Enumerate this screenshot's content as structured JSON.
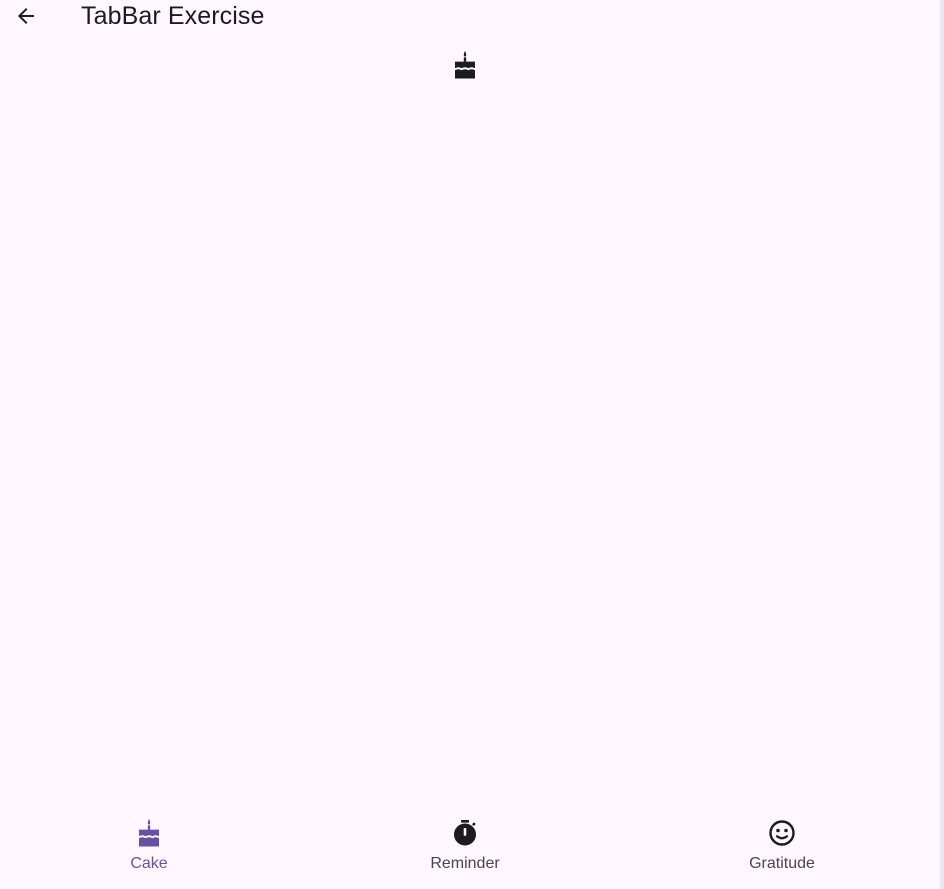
{
  "app_bar": {
    "title": "TabBar Exercise",
    "back_icon": "arrow-back-icon"
  },
  "content": {
    "icon": "cake-icon"
  },
  "tabs": [
    {
      "label": "Cake",
      "icon": "cake-icon",
      "selected": true
    },
    {
      "label": "Reminder",
      "icon": "timer-icon",
      "selected": false
    },
    {
      "label": "Gratitude",
      "icon": "smiley-icon",
      "selected": false
    }
  ],
  "colors": {
    "background": "#fef7ff",
    "selected_tab": "#6750a4",
    "unselected_tab": "#49454f",
    "text": "#1d1b20"
  }
}
